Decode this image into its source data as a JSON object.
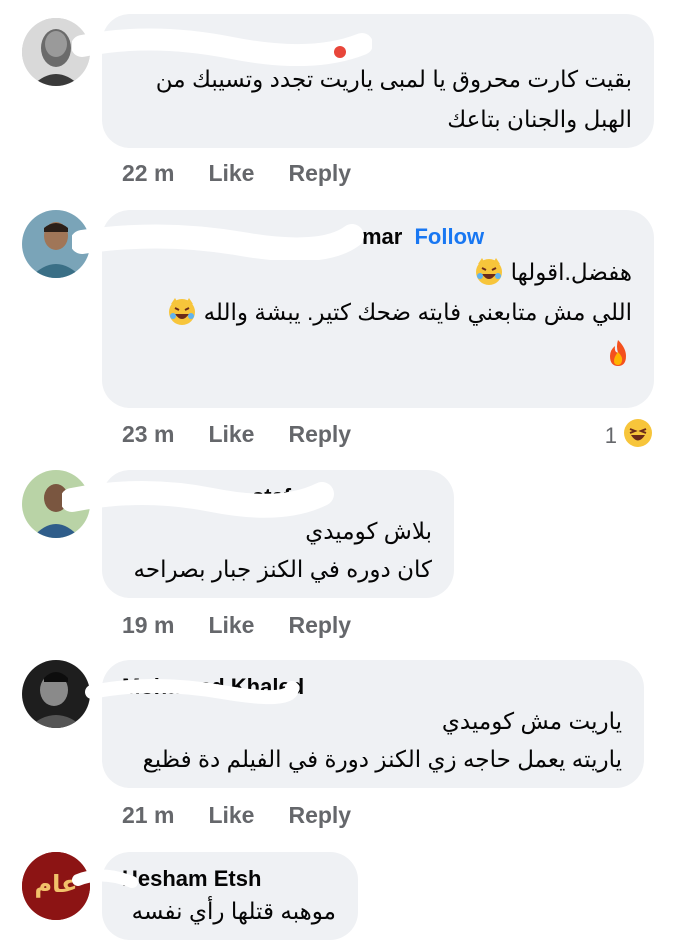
{
  "comments": [
    {
      "author": "",
      "lines": [
        "بقيت كارت محروق يا لمبى ياريت تجدد وتسيبك من",
        "الهبل والجنان بتاعك"
      ],
      "time": "22 m",
      "like": "Like",
      "reply": "Reply"
    },
    {
      "author": "mar",
      "follow": "Follow",
      "lines": [
        "هفضل.اقولها",
        "اللي مش متابعني فايته ضحك كتير. يبشة والله"
      ],
      "time": "23 m",
      "like": "Like",
      "reply": "Reply",
      "reaction_count": "1"
    },
    {
      "author": "stafa",
      "lines": [
        "بلاش كوميدي",
        "كان دوره في الكنز جبار بصراحه"
      ],
      "time": "19 m",
      "like": "Like",
      "reply": "Reply"
    },
    {
      "author": "Mohamed Khaled",
      "lines": [
        "ياريت مش كوميدي",
        "ياريته يعمل حاجه زي الكنز دورة في الفيلم دة فظيع"
      ],
      "time": "21 m",
      "like": "Like",
      "reply": "Reply"
    },
    {
      "author": "Hesham Etsh",
      "avatar_text": "عام",
      "lines": [
        "موهبه قتلها رأي نفسه"
      ]
    }
  ],
  "colors": {
    "bubble": "#eff1f4",
    "meta": "#65676b",
    "follow": "#1877f2",
    "scribble": "#ffffff"
  },
  "icons": [
    "laughing-crying-cat-emoji",
    "fire-emoji",
    "laughing-reaction-icon"
  ]
}
